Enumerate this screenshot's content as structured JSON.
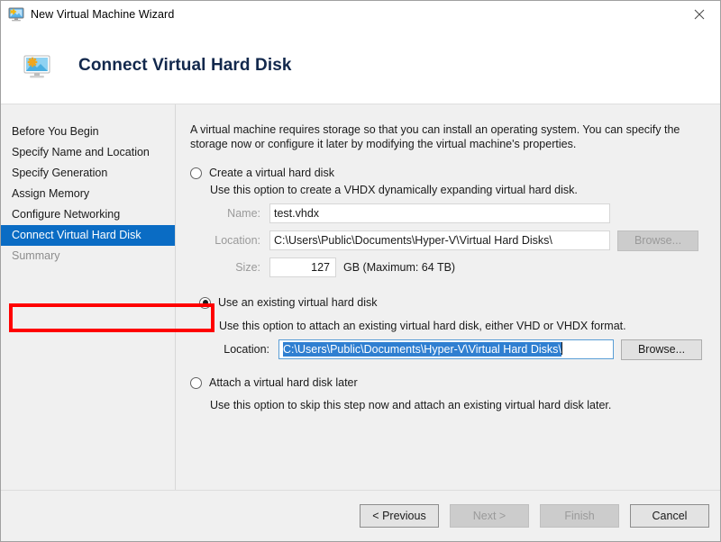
{
  "window": {
    "title": "New Virtual Machine Wizard",
    "title_icon": "virtual-machine-icon",
    "close_icon": "close-icon"
  },
  "header": {
    "icon": "virtual-machine-icon",
    "title": "Connect Virtual Hard Disk"
  },
  "sidebar": {
    "items": [
      {
        "label": "Before You Begin",
        "state": "normal"
      },
      {
        "label": "Specify Name and Location",
        "state": "normal"
      },
      {
        "label": "Specify Generation",
        "state": "normal"
      },
      {
        "label": "Assign Memory",
        "state": "normal"
      },
      {
        "label": "Configure Networking",
        "state": "normal"
      },
      {
        "label": "Connect Virtual Hard Disk",
        "state": "selected"
      },
      {
        "label": "Summary",
        "state": "disabled"
      }
    ]
  },
  "content": {
    "intro": "A virtual machine requires storage so that you can install an operating system. You can specify the storage now or configure it later by modifying the virtual machine's properties.",
    "options": [
      {
        "label": "Create a virtual hard disk",
        "description": "Use this option to create a VHDX dynamically expanding virtual hard disk.",
        "selected": false
      },
      {
        "label": "Use an existing virtual hard disk",
        "description": "Use this option to attach an existing virtual hard disk, either VHD or VHDX format.",
        "selected": true,
        "highlighted": true
      },
      {
        "label": "Attach a virtual hard disk later",
        "description": "Use this option to skip this step now and attach an existing virtual hard disk later.",
        "selected": false
      }
    ],
    "create_fields": {
      "name_label": "Name:",
      "name_value": "test.vhdx",
      "location_label": "Location:",
      "location_value": "C:\\Users\\Public\\Documents\\Hyper-V\\Virtual Hard Disks\\",
      "browse_label": "Browse...",
      "size_label": "Size:",
      "size_value": "127",
      "size_suffix": "GB (Maximum: 64 TB)"
    },
    "existing_fields": {
      "location_label": "Location:",
      "location_value": "C:\\Users\\Public\\Documents\\Hyper-V\\Virtual Hard Disks\\",
      "browse_label": "Browse..."
    }
  },
  "footer": {
    "previous_label": "< Previous",
    "next_label": "Next >",
    "finish_label": "Finish",
    "cancel_label": "Cancel"
  },
  "colors": {
    "accent_blue": "#0a6cc4",
    "selection_blue": "#2f7fd1",
    "annotation_red": "#ff0000",
    "header_title": "#12284c",
    "body_bg": "#f0f0f0"
  }
}
